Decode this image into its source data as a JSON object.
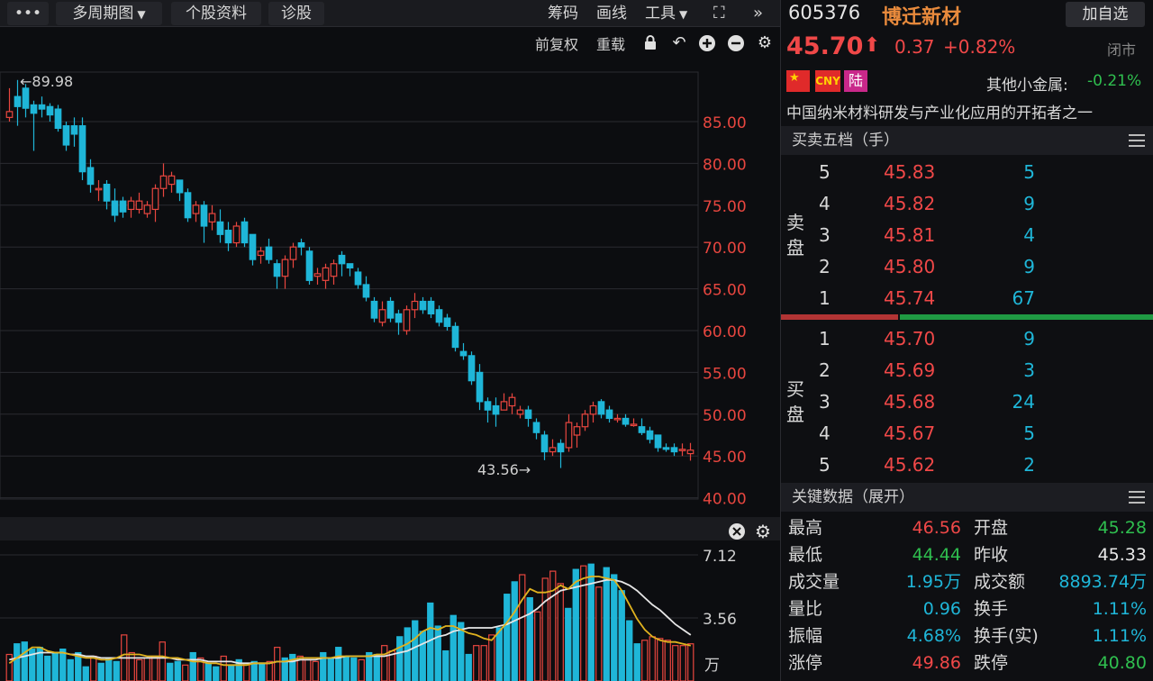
{
  "toolbar": {
    "more_label": "•••",
    "period_label": "多周期图",
    "profile_label": "个股资料",
    "diagnose_label": "诊股",
    "chips_label": "筹码",
    "draw_label": "画线",
    "tools_label": "工具"
  },
  "chart_header": {
    "adjust_label": "前复权",
    "overlay_label": "重载"
  },
  "chart_data": {
    "type": "candlestick",
    "y_ticks": [
      "85.00",
      "80.00",
      "75.00",
      "70.00",
      "65.00",
      "60.00",
      "55.00",
      "50.00",
      "45.00",
      "40.00"
    ],
    "ylim": [
      40,
      92
    ],
    "high_annotation": "←89.98",
    "low_annotation": "43.56→",
    "candles": [
      [
        85.5,
        86.2,
        85.0,
        89.0
      ],
      [
        88.0,
        86.8,
        84.5,
        89.98
      ],
      [
        89.0,
        86.6,
        85.5,
        89.5
      ],
      [
        87.0,
        86.0,
        81.5,
        87.5
      ],
      [
        87.0,
        86.5,
        85.5,
        88.0
      ],
      [
        86.8,
        85.8,
        85.0,
        87.2
      ],
      [
        86.5,
        84.2,
        83.8,
        87.0
      ],
      [
        84.5,
        82.2,
        81.5,
        85.0
      ],
      [
        84.5,
        83.5,
        82.0,
        85.5
      ],
      [
        84.5,
        79.0,
        78.0,
        85.5
      ],
      [
        79.5,
        77.5,
        76.5,
        80.5
      ],
      [
        77.0,
        77.0,
        75.5,
        78.0
      ],
      [
        77.5,
        75.5,
        74.5,
        78.0
      ],
      [
        75.5,
        73.8,
        73.0,
        77.0
      ],
      [
        75.5,
        74.2,
        73.5,
        76.0
      ],
      [
        74.5,
        75.5,
        73.5,
        76.0
      ],
      [
        74.5,
        75.5,
        74.0,
        76.5
      ],
      [
        74.0,
        75.0,
        73.5,
        75.5
      ],
      [
        74.5,
        77.0,
        73.0,
        77.5
      ],
      [
        77.0,
        78.5,
        76.0,
        80.0
      ],
      [
        77.5,
        78.5,
        76.5,
        79.0
      ],
      [
        78.0,
        76.5,
        75.5,
        78.0
      ],
      [
        76.5,
        73.5,
        73.0,
        77.0
      ],
      [
        74.0,
        75.0,
        73.0,
        75.5
      ],
      [
        75.0,
        72.5,
        70.5,
        75.5
      ],
      [
        73.0,
        74.0,
        72.0,
        75.0
      ],
      [
        73.0,
        71.5,
        70.5,
        74.5
      ],
      [
        72.0,
        70.5,
        69.5,
        73.0
      ],
      [
        70.5,
        72.5,
        70.0,
        73.0
      ],
      [
        73.0,
        70.5,
        70.0,
        73.5
      ],
      [
        71.5,
        68.5,
        67.8,
        71.5
      ],
      [
        69.0,
        69.5,
        68.0,
        70.0
      ],
      [
        70.0,
        68.5,
        68.0,
        71.0
      ],
      [
        68.0,
        66.5,
        65.0,
        68.5
      ],
      [
        66.5,
        68.5,
        65.0,
        69.0
      ],
      [
        68.5,
        70.0,
        67.5,
        70.5
      ],
      [
        70.5,
        70.0,
        69.0,
        71.0
      ],
      [
        69.5,
        66.0,
        65.5,
        70.0
      ],
      [
        66.5,
        66.8,
        65.5,
        67.5
      ],
      [
        66.0,
        67.5,
        65.0,
        68.0
      ],
      [
        66.5,
        68.0,
        65.5,
        68.5
      ],
      [
        69.0,
        68.0,
        66.5,
        69.5
      ],
      [
        68.0,
        67.5,
        66.5,
        68.0
      ],
      [
        67.0,
        65.5,
        65.0,
        67.5
      ],
      [
        65.5,
        64.0,
        63.5,
        66.5
      ],
      [
        63.5,
        61.5,
        61.0,
        64.0
      ],
      [
        61.0,
        62.5,
        60.5,
        63.5
      ],
      [
        63.5,
        61.5,
        61.0,
        64.0
      ],
      [
        62.0,
        61.0,
        59.5,
        62.5
      ],
      [
        60.0,
        62.5,
        59.5,
        63.0
      ],
      [
        62.5,
        63.5,
        61.5,
        64.5
      ],
      [
        63.5,
        62.5,
        62.0,
        64.0
      ],
      [
        63.5,
        62.0,
        61.5,
        64.0
      ],
      [
        62.5,
        61.0,
        60.5,
        63.0
      ],
      [
        61.5,
        60.5,
        60.0,
        62.0
      ],
      [
        60.5,
        58.0,
        57.5,
        61.0
      ],
      [
        57.5,
        57.0,
        56.5,
        58.5
      ],
      [
        57.0,
        54.0,
        53.5,
        57.5
      ],
      [
        55.0,
        51.5,
        50.5,
        56.0
      ],
      [
        51.5,
        50.5,
        49.0,
        52.0
      ],
      [
        51.0,
        50.0,
        48.5,
        52.0
      ],
      [
        50.5,
        51.5,
        50.5,
        52.5
      ],
      [
        51.0,
        52.0,
        50.0,
        52.5
      ],
      [
        50.0,
        50.5,
        49.5,
        51.0
      ],
      [
        50.5,
        49.5,
        48.5,
        51.0
      ],
      [
        49.0,
        47.8,
        47.0,
        49.5
      ],
      [
        47.5,
        45.5,
        44.5,
        48.0
      ],
      [
        45.5,
        46.0,
        45.0,
        47.0
      ],
      [
        46.5,
        45.5,
        43.56,
        47.0
      ],
      [
        46.0,
        49.0,
        45.5,
        50.0
      ],
      [
        47.5,
        48.5,
        46.0,
        49.0
      ],
      [
        48.5,
        50.0,
        48.0,
        50.5
      ],
      [
        50.0,
        51.0,
        49.0,
        51.5
      ],
      [
        51.5,
        50.0,
        49.5,
        51.8
      ],
      [
        50.5,
        49.5,
        49.0,
        51.0
      ],
      [
        49.5,
        49.5,
        49.0,
        50.0
      ],
      [
        49.5,
        48.8,
        48.5,
        50.0
      ],
      [
        48.8,
        48.8,
        48.5,
        49.5
      ],
      [
        48.5,
        47.8,
        47.5,
        49.5
      ],
      [
        48.0,
        47.0,
        46.5,
        48.5
      ],
      [
        47.5,
        46.0,
        45.5,
        47.5
      ],
      [
        46.0,
        45.8,
        45.5,
        46.5
      ],
      [
        46.0,
        45.5,
        45.0,
        46.5
      ],
      [
        45.8,
        45.8,
        45.0,
        46.5
      ],
      [
        45.28,
        45.7,
        44.44,
        46.56
      ]
    ],
    "volume": {
      "y_ticks": [
        "7.12",
        "3.56"
      ],
      "unit": "万",
      "ylim": [
        0,
        7.12
      ],
      "values": [
        1.5,
        2.1,
        2.2,
        1.8,
        1.9,
        1.4,
        1.6,
        1.8,
        1.2,
        1.6,
        0.8,
        1.4,
        1.0,
        1.3,
        1.1,
        2.6,
        1.6,
        1.2,
        1.3,
        1.4,
        2.2,
        1.0,
        1.1,
        0.9,
        1.6,
        1.3,
        1.0,
        0.8,
        1.4,
        0.9,
        1.2,
        1.0,
        1.1,
        1.0,
        1.1,
        1.9,
        1.3,
        1.5,
        1.4,
        1.2,
        1.1,
        1.6,
        1.3,
        1.9,
        1.4,
        1.3,
        1.2,
        1.6,
        1.5,
        2.0,
        1.7,
        2.5,
        3.0,
        3.4,
        2.8,
        4.4,
        3.1,
        1.7,
        3.7,
        3.3,
        1.5,
        2.0,
        2.0,
        2.6,
        3.0,
        4.9,
        5.6,
        6.0,
        4.7,
        3.9,
        5.8,
        6.2,
        5.5,
        4.1,
        6.3,
        6.5,
        6.6,
        5.3,
        6.4,
        6.0,
        5.1,
        3.4,
        2.1,
        2.3,
        2.5,
        2.4,
        2.3,
        2.0,
        2.0,
        2.1
      ],
      "ma5": [
        1.0,
        1.3,
        1.6,
        1.9,
        1.9,
        1.7,
        1.6,
        1.6,
        1.5,
        1.4,
        1.3,
        1.3,
        1.2,
        1.2,
        1.3,
        1.5,
        1.5,
        1.5,
        1.4,
        1.4,
        1.4,
        1.3,
        1.3,
        1.2,
        1.1,
        1.1,
        1.0,
        1.0,
        0.9,
        0.9,
        0.9,
        0.9,
        1.0,
        1.0,
        1.0,
        1.1,
        1.1,
        1.2,
        1.3,
        1.3,
        1.3,
        1.3,
        1.3,
        1.4,
        1.4,
        1.4,
        1.4,
        1.4,
        1.5,
        1.5,
        1.7,
        1.9,
        2.1,
        2.4,
        2.8,
        3.0,
        2.9,
        3.1,
        3.1,
        2.9,
        2.7,
        2.6,
        2.4,
        2.3,
        2.8,
        3.3,
        3.9,
        4.6,
        5.2,
        5.0,
        5.0,
        5.1,
        5.4,
        5.2,
        5.6,
        5.8,
        5.9,
        5.9,
        5.8,
        5.7,
        5.1,
        4.3,
        3.5,
        2.9,
        2.5,
        2.3,
        2.2,
        2.2,
        2.1,
        2.0
      ],
      "ma10": [
        1.2,
        1.3,
        1.4,
        1.5,
        1.6,
        1.6,
        1.6,
        1.6,
        1.5,
        1.5,
        1.4,
        1.4,
        1.3,
        1.3,
        1.3,
        1.3,
        1.3,
        1.3,
        1.3,
        1.3,
        1.3,
        1.3,
        1.2,
        1.2,
        1.2,
        1.2,
        1.1,
        1.1,
        1.1,
        1.1,
        1.0,
        1.0,
        1.0,
        1.0,
        1.0,
        1.1,
        1.1,
        1.1,
        1.2,
        1.2,
        1.2,
        1.3,
        1.3,
        1.3,
        1.4,
        1.4,
        1.4,
        1.4,
        1.4,
        1.4,
        1.5,
        1.6,
        1.7,
        1.9,
        2.1,
        2.3,
        2.5,
        2.6,
        2.8,
        2.9,
        3.0,
        3.0,
        3.0,
        3.0,
        3.1,
        3.2,
        3.4,
        3.6,
        3.8,
        4.1,
        4.5,
        4.8,
        5.1,
        5.2,
        5.3,
        5.4,
        5.5,
        5.6,
        5.7,
        5.7,
        5.6,
        5.4,
        5.1,
        4.7,
        4.3,
        4.0,
        3.6,
        3.2,
        2.9,
        2.6
      ]
    }
  },
  "stock": {
    "code": "605376",
    "name": "博迁新材",
    "add_watch_label": "加自选",
    "price": "45.70",
    "arrow": "⬆",
    "change": "0.37",
    "change_pct": "+0.82%",
    "status": "闭市",
    "badge_cny": "CNY",
    "badge_market": "陆",
    "sector_label": "其他小金属:",
    "sector_change": "-0.21%",
    "slogan": "中国纳米材料研发与产业化应用的开拓者之一"
  },
  "orderbook": {
    "title": "买卖五档（手）",
    "sell_label_1": "卖",
    "sell_label_2": "盘",
    "buy_label_1": "买",
    "buy_label_2": "盘",
    "sell": [
      {
        "idx": "5",
        "price": "45.83",
        "vol": "5"
      },
      {
        "idx": "4",
        "price": "45.82",
        "vol": "9"
      },
      {
        "idx": "3",
        "price": "45.81",
        "vol": "4"
      },
      {
        "idx": "2",
        "price": "45.80",
        "vol": "9"
      },
      {
        "idx": "1",
        "price": "45.74",
        "vol": "67"
      }
    ],
    "buy": [
      {
        "idx": "1",
        "price": "45.70",
        "vol": "9"
      },
      {
        "idx": "2",
        "price": "45.69",
        "vol": "3"
      },
      {
        "idx": "3",
        "price": "45.68",
        "vol": "24"
      },
      {
        "idx": "4",
        "price": "45.67",
        "vol": "5"
      },
      {
        "idx": "5",
        "price": "45.62",
        "vol": "2"
      }
    ]
  },
  "key_data": {
    "title": "关键数据（展开）",
    "rows": [
      {
        "l1": "最高",
        "v1": "46.56",
        "c1": "red",
        "l2": "开盘",
        "v2": "45.28",
        "c2": "green"
      },
      {
        "l1": "最低",
        "v1": "44.44",
        "c1": "green",
        "l2": "昨收",
        "v2": "45.33",
        "c2": "white"
      },
      {
        "l1": "成交量",
        "v1": "1.95万",
        "c1": "cyan",
        "l2": "成交额",
        "v2": "8893.74万",
        "c2": "cyan"
      },
      {
        "l1": "量比",
        "v1": "0.96",
        "c1": "cyan",
        "l2": "换手",
        "v2": "1.11%",
        "c2": "cyan"
      },
      {
        "l1": "振幅",
        "v1": "4.68%",
        "c1": "cyan",
        "l2": "换手(实)",
        "v2": "1.11%",
        "c2": "cyan"
      },
      {
        "l1": "涨停",
        "v1": "49.86",
        "c1": "red",
        "l2": "跌停",
        "v2": "40.80",
        "c2": "green"
      }
    ]
  },
  "colors": {
    "up": "#e8463f",
    "down": "#1fb6d8",
    "ma5": "#e0b21f",
    "ma10": "#e6e6e6"
  }
}
